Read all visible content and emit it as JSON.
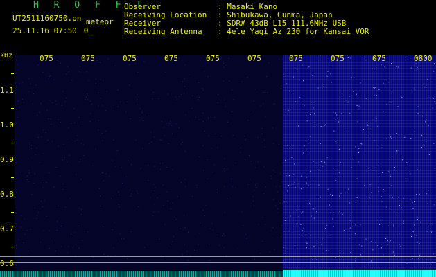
{
  "header": {
    "app_title": "H R O F F T",
    "file_name": "UT2511160750.pn",
    "meteor_label": "meteor",
    "timestamp": "25.11.16 07:50",
    "count": "0_"
  },
  "info": {
    "rows": [
      {
        "key": "Observer",
        "value": ": Masaki Kano"
      },
      {
        "key": "Receiving Location",
        "value": ": Shibukawa, Gunma, Japan"
      },
      {
        "key": "Receiver",
        "value": ": SDR# 43dB L15 111.6MHz USB"
      },
      {
        "key": "Receiving Antenna",
        "value": ": 4ele Yagi Az 230 for Kansai VOR"
      }
    ]
  },
  "axis": {
    "unit": "kHz",
    "time_ticks": [
      "075",
      "075",
      "075",
      "075",
      "075",
      "075",
      "075",
      "075",
      "075",
      "0800"
    ],
    "freq_ticks": [
      "1.1",
      "1.0",
      "0.9",
      "0.8",
      "0.7",
      "0.6"
    ]
  }
}
